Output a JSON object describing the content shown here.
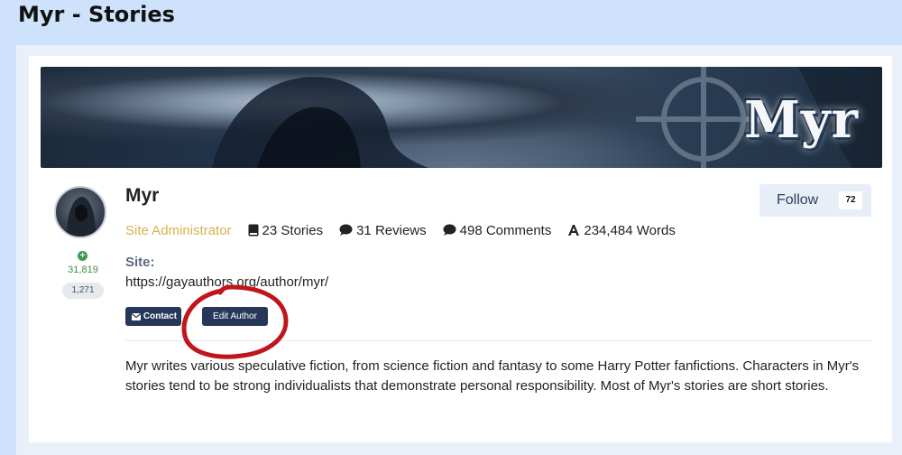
{
  "page": {
    "title": "Myr - Stories"
  },
  "banner": {
    "logo_text": "Myr"
  },
  "author": {
    "name": "Myr",
    "role": "Site Administrator",
    "reputation": "31,819",
    "posts": "1,271"
  },
  "stats": {
    "stories": "23 Stories",
    "reviews": "31 Reviews",
    "comments": "498 Comments",
    "words": "234,484 Words"
  },
  "site": {
    "label": "Site:",
    "url": "https://gayauthors.org/author/myr/"
  },
  "buttons": {
    "contact": "Contact",
    "edit_author": "Edit Author",
    "follow": "Follow",
    "follow_count": "72"
  },
  "bio": "Myr writes various speculative fiction, from science fiction and fantasy to some Harry Potter fanfictions. Characters in Myr's stories tend to be strong individualists that demonstrate personal responsibility. Most of Myr's stories are short stories.",
  "colors": {
    "background": "#cfe2fb",
    "button": "#27375a",
    "role": "#d6b24a",
    "reputation": "#3f8d49",
    "annotation": "#c0151b"
  },
  "icons": [
    "book-icon",
    "speech-bubble-icon",
    "comment-icon",
    "font-icon",
    "envelope-icon",
    "plus-icon"
  ]
}
